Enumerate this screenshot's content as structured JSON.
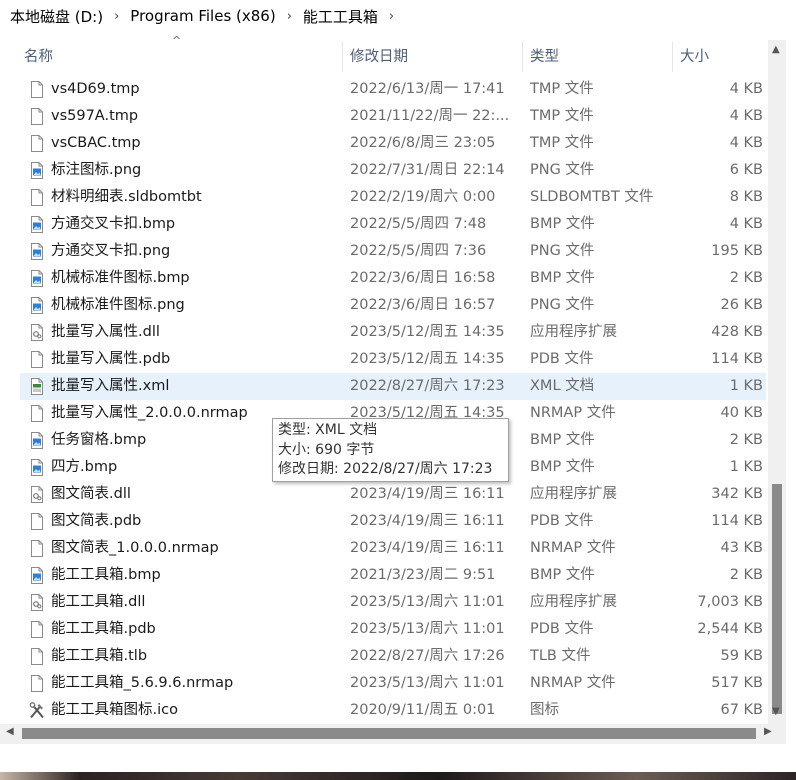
{
  "breadcrumb": {
    "items": [
      "本地磁盘 (D:)",
      "Program Files (x86)",
      "能工工具箱"
    ],
    "separator": "›"
  },
  "columns": {
    "name": "名称",
    "modified": "修改日期",
    "type": "类型",
    "size": "大小",
    "sort_indicator": "^"
  },
  "files": [
    {
      "name": "vs4D69.tmp",
      "modified": "2022/6/13/周一 17:41",
      "type": "TMP 文件",
      "size": "4 KB",
      "icon": "blank-file-icon"
    },
    {
      "name": "vs597A.tmp",
      "modified": "2021/11/22/周一 22:...",
      "type": "TMP 文件",
      "size": "4 KB",
      "icon": "blank-file-icon"
    },
    {
      "name": "vsCBAC.tmp",
      "modified": "2022/6/8/周三 23:05",
      "type": "TMP 文件",
      "size": "4 KB",
      "icon": "blank-file-icon"
    },
    {
      "name": "标注图标.png",
      "modified": "2022/7/31/周日 22:14",
      "type": "PNG 文件",
      "size": "6 KB",
      "icon": "image-file-icon"
    },
    {
      "name": "材料明细表.sldbomtbt",
      "modified": "2022/2/19/周六 0:00",
      "type": "SLDBOMTBT 文件",
      "size": "8 KB",
      "icon": "blank-file-icon"
    },
    {
      "name": "方通交叉卡扣.bmp",
      "modified": "2022/5/5/周四 7:48",
      "type": "BMP 文件",
      "size": "4 KB",
      "icon": "image-file-icon"
    },
    {
      "name": "方通交叉卡扣.png",
      "modified": "2022/5/5/周四 7:36",
      "type": "PNG 文件",
      "size": "195 KB",
      "icon": "image-file-icon"
    },
    {
      "name": "机械标准件图标.bmp",
      "modified": "2022/3/6/周日 16:58",
      "type": "BMP 文件",
      "size": "2 KB",
      "icon": "image-file-icon"
    },
    {
      "name": "机械标准件图标.png",
      "modified": "2022/3/6/周日 16:57",
      "type": "PNG 文件",
      "size": "26 KB",
      "icon": "image-file-icon"
    },
    {
      "name": "批量写入属性.dll",
      "modified": "2023/5/12/周五 14:35",
      "type": "应用程序扩展",
      "size": "428 KB",
      "icon": "dll-file-icon"
    },
    {
      "name": "批量写入属性.pdb",
      "modified": "2023/5/12/周五 14:35",
      "type": "PDB 文件",
      "size": "114 KB",
      "icon": "blank-file-icon"
    },
    {
      "name": "批量写入属性.xml",
      "modified": "2022/8/27/周六 17:23",
      "type": "XML 文档",
      "size": "1 KB",
      "icon": "xml-file-icon",
      "selected": true
    },
    {
      "name": "批量写入属性_2.0.0.0.nrmap",
      "modified": "2023/5/12/周五 14:35",
      "type": "NRMAP 文件",
      "size": "40 KB",
      "icon": "blank-file-icon"
    },
    {
      "name": "任务窗格.bmp",
      "modified": "",
      "type": "BMP 文件",
      "size": "2 KB",
      "icon": "image-file-icon"
    },
    {
      "name": "四方.bmp",
      "modified": "",
      "type": "BMP 文件",
      "size": "1 KB",
      "icon": "image-file-icon"
    },
    {
      "name": "图文简表.dll",
      "modified": "2023/4/19/周三 16:11",
      "type": "应用程序扩展",
      "size": "342 KB",
      "icon": "dll-file-icon"
    },
    {
      "name": "图文简表.pdb",
      "modified": "2023/4/19/周三 16:11",
      "type": "PDB 文件",
      "size": "114 KB",
      "icon": "blank-file-icon"
    },
    {
      "name": "图文简表_1.0.0.0.nrmap",
      "modified": "2023/4/19/周三 16:11",
      "type": "NRMAP 文件",
      "size": "43 KB",
      "icon": "blank-file-icon"
    },
    {
      "name": "能工工具箱.bmp",
      "modified": "2021/3/23/周二 9:51",
      "type": "BMP 文件",
      "size": "2 KB",
      "icon": "image-file-icon"
    },
    {
      "name": "能工工具箱.dll",
      "modified": "2023/5/13/周六 11:01",
      "type": "应用程序扩展",
      "size": "7,003 KB",
      "icon": "dll-file-icon"
    },
    {
      "name": "能工工具箱.pdb",
      "modified": "2023/5/13/周六 11:01",
      "type": "PDB 文件",
      "size": "2,544 KB",
      "icon": "blank-file-icon"
    },
    {
      "name": "能工工具箱.tlb",
      "modified": "2022/8/27/周六 17:26",
      "type": "TLB 文件",
      "size": "59 KB",
      "icon": "blank-file-icon"
    },
    {
      "name": "能工工具箱_5.6.9.6.nrmap",
      "modified": "2023/5/13/周六 11:01",
      "type": "NRMAP 文件",
      "size": "517 KB",
      "icon": "blank-file-icon"
    },
    {
      "name": "能工工具箱图标.ico",
      "modified": "2020/9/11/周五 0:01",
      "type": "图标",
      "size": "67 KB",
      "icon": "tools-icon"
    }
  ],
  "tooltip": {
    "type_line": "类型: XML 文档",
    "size_line": "大小: 690 字节",
    "modified_line": "修改日期: 2022/8/27/周六 17:23"
  },
  "colors": {
    "selected_row": "#e6f1fb",
    "header_text": "#4c607a",
    "detail_text": "#6b6b6b"
  }
}
